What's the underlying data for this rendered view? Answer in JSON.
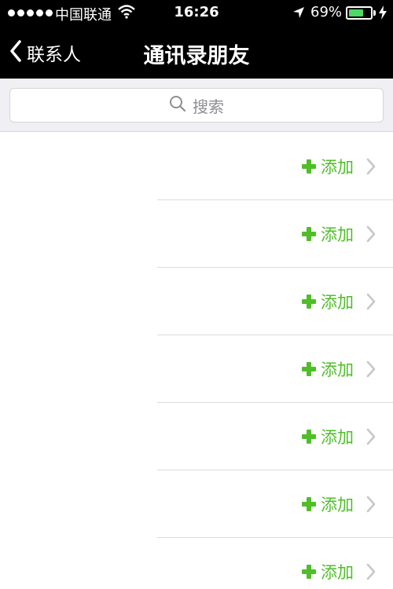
{
  "status_bar": {
    "carrier": "中国联通",
    "time": "16:26",
    "battery": "69%",
    "battery_level": 0.69,
    "icons": [
      "signal-dots-icon",
      "wifi-icon",
      "location-arrow-icon",
      "battery-icon",
      "charging-bolt-icon"
    ]
  },
  "nav": {
    "back_label": "联系人",
    "title": "通讯录朋友"
  },
  "search": {
    "placeholder": "搜索",
    "icon": "search-icon"
  },
  "contacts": {
    "rows": [
      {
        "action": "添加"
      },
      {
        "action": "添加"
      },
      {
        "action": "添加"
      },
      {
        "action": "添加"
      },
      {
        "action": "添加"
      },
      {
        "action": "添加"
      },
      {
        "action": "添加"
      }
    ]
  },
  "colors": {
    "accent": "#4fbe29",
    "nav_bg": "#000000",
    "search_bg": "#efeff4"
  }
}
